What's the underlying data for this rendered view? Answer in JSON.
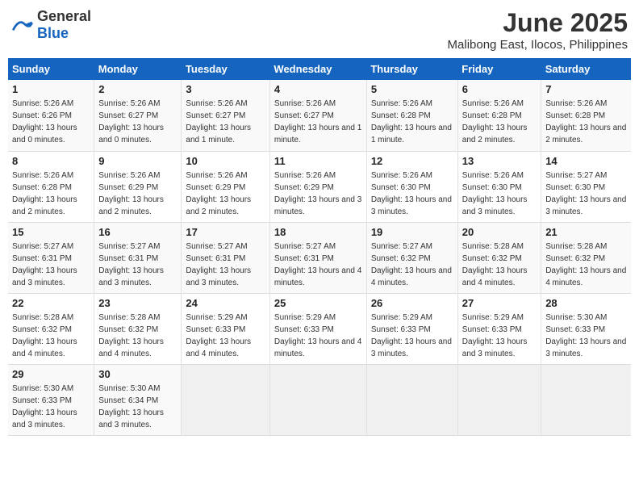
{
  "logo": {
    "general": "General",
    "blue": "Blue"
  },
  "title": "June 2025",
  "location": "Malibong East, Ilocos, Philippines",
  "headers": [
    "Sunday",
    "Monday",
    "Tuesday",
    "Wednesday",
    "Thursday",
    "Friday",
    "Saturday"
  ],
  "weeks": [
    [
      {
        "day": "1",
        "sunrise": "5:26 AM",
        "sunset": "6:26 PM",
        "daylight": "13 hours and 0 minutes."
      },
      {
        "day": "2",
        "sunrise": "5:26 AM",
        "sunset": "6:27 PM",
        "daylight": "13 hours and 0 minutes."
      },
      {
        "day": "3",
        "sunrise": "5:26 AM",
        "sunset": "6:27 PM",
        "daylight": "13 hours and 1 minute."
      },
      {
        "day": "4",
        "sunrise": "5:26 AM",
        "sunset": "6:27 PM",
        "daylight": "13 hours and 1 minute."
      },
      {
        "day": "5",
        "sunrise": "5:26 AM",
        "sunset": "6:28 PM",
        "daylight": "13 hours and 1 minute."
      },
      {
        "day": "6",
        "sunrise": "5:26 AM",
        "sunset": "6:28 PM",
        "daylight": "13 hours and 2 minutes."
      },
      {
        "day": "7",
        "sunrise": "5:26 AM",
        "sunset": "6:28 PM",
        "daylight": "13 hours and 2 minutes."
      }
    ],
    [
      {
        "day": "8",
        "sunrise": "5:26 AM",
        "sunset": "6:28 PM",
        "daylight": "13 hours and 2 minutes."
      },
      {
        "day": "9",
        "sunrise": "5:26 AM",
        "sunset": "6:29 PM",
        "daylight": "13 hours and 2 minutes."
      },
      {
        "day": "10",
        "sunrise": "5:26 AM",
        "sunset": "6:29 PM",
        "daylight": "13 hours and 2 minutes."
      },
      {
        "day": "11",
        "sunrise": "5:26 AM",
        "sunset": "6:29 PM",
        "daylight": "13 hours and 3 minutes."
      },
      {
        "day": "12",
        "sunrise": "5:26 AM",
        "sunset": "6:30 PM",
        "daylight": "13 hours and 3 minutes."
      },
      {
        "day": "13",
        "sunrise": "5:26 AM",
        "sunset": "6:30 PM",
        "daylight": "13 hours and 3 minutes."
      },
      {
        "day": "14",
        "sunrise": "5:27 AM",
        "sunset": "6:30 PM",
        "daylight": "13 hours and 3 minutes."
      }
    ],
    [
      {
        "day": "15",
        "sunrise": "5:27 AM",
        "sunset": "6:31 PM",
        "daylight": "13 hours and 3 minutes."
      },
      {
        "day": "16",
        "sunrise": "5:27 AM",
        "sunset": "6:31 PM",
        "daylight": "13 hours and 3 minutes."
      },
      {
        "day": "17",
        "sunrise": "5:27 AM",
        "sunset": "6:31 PM",
        "daylight": "13 hours and 3 minutes."
      },
      {
        "day": "18",
        "sunrise": "5:27 AM",
        "sunset": "6:31 PM",
        "daylight": "13 hours and 4 minutes."
      },
      {
        "day": "19",
        "sunrise": "5:27 AM",
        "sunset": "6:32 PM",
        "daylight": "13 hours and 4 minutes."
      },
      {
        "day": "20",
        "sunrise": "5:28 AM",
        "sunset": "6:32 PM",
        "daylight": "13 hours and 4 minutes."
      },
      {
        "day": "21",
        "sunrise": "5:28 AM",
        "sunset": "6:32 PM",
        "daylight": "13 hours and 4 minutes."
      }
    ],
    [
      {
        "day": "22",
        "sunrise": "5:28 AM",
        "sunset": "6:32 PM",
        "daylight": "13 hours and 4 minutes."
      },
      {
        "day": "23",
        "sunrise": "5:28 AM",
        "sunset": "6:32 PM",
        "daylight": "13 hours and 4 minutes."
      },
      {
        "day": "24",
        "sunrise": "5:29 AM",
        "sunset": "6:33 PM",
        "daylight": "13 hours and 4 minutes."
      },
      {
        "day": "25",
        "sunrise": "5:29 AM",
        "sunset": "6:33 PM",
        "daylight": "13 hours and 4 minutes."
      },
      {
        "day": "26",
        "sunrise": "5:29 AM",
        "sunset": "6:33 PM",
        "daylight": "13 hours and 3 minutes."
      },
      {
        "day": "27",
        "sunrise": "5:29 AM",
        "sunset": "6:33 PM",
        "daylight": "13 hours and 3 minutes."
      },
      {
        "day": "28",
        "sunrise": "5:30 AM",
        "sunset": "6:33 PM",
        "daylight": "13 hours and 3 minutes."
      }
    ],
    [
      {
        "day": "29",
        "sunrise": "5:30 AM",
        "sunset": "6:33 PM",
        "daylight": "13 hours and 3 minutes."
      },
      {
        "day": "30",
        "sunrise": "5:30 AM",
        "sunset": "6:34 PM",
        "daylight": "13 hours and 3 minutes."
      },
      null,
      null,
      null,
      null,
      null
    ]
  ],
  "labels": {
    "sunrise_prefix": "Sunrise: ",
    "sunset_prefix": "Sunset: ",
    "daylight_label": "Daylight: "
  }
}
